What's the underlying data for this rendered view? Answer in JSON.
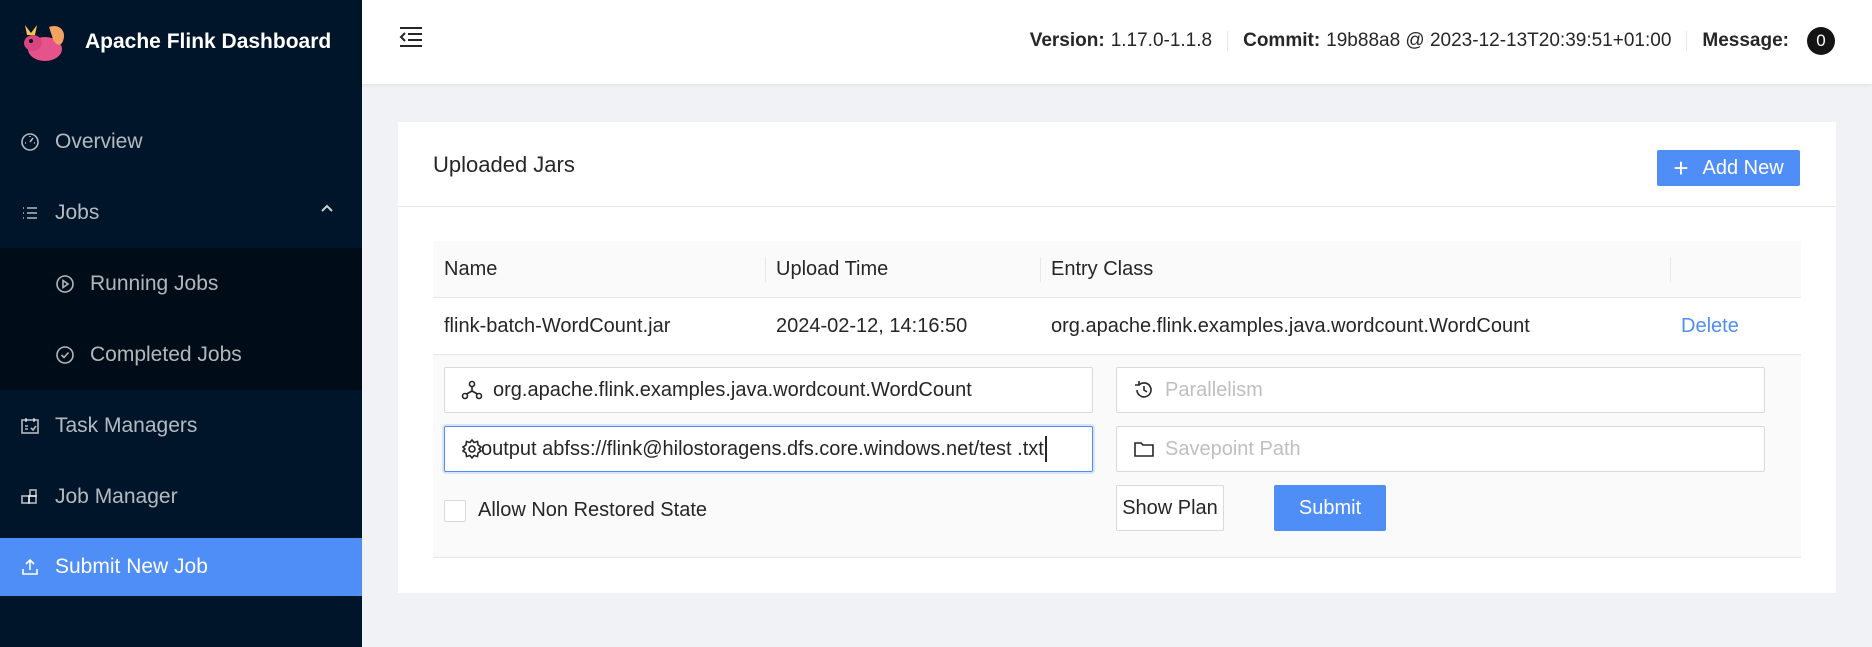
{
  "app": {
    "title": "Apache Flink Dashboard"
  },
  "sidebar": {
    "items": [
      {
        "label": "Overview",
        "icon": "dashboard-icon"
      },
      {
        "label": "Jobs",
        "icon": "list-icon",
        "expanded": true,
        "children": [
          {
            "label": "Running Jobs",
            "icon": "play-circle-icon"
          },
          {
            "label": "Completed Jobs",
            "icon": "check-circle-icon"
          }
        ]
      },
      {
        "label": "Task Managers",
        "icon": "schedule-icon"
      },
      {
        "label": "Job Manager",
        "icon": "build-icon"
      },
      {
        "label": "Submit New Job",
        "icon": "upload-icon",
        "active": true
      }
    ]
  },
  "header": {
    "version_label": "Version:",
    "version": "1.17.0-1.1.8",
    "commit_label": "Commit:",
    "commit": "19b88a8 @ 2023-12-13T20:39:51+01:00",
    "message_label": "Message:",
    "message_count": "0"
  },
  "card": {
    "title": "Uploaded Jars",
    "add_button": "Add New",
    "columns": [
      "Name",
      "Upload Time",
      "Entry Class"
    ],
    "rows": [
      {
        "name": "flink-batch-WordCount.jar",
        "upload_time": "2024-02-12, 14:16:50",
        "entry_class": "org.apache.flink.examples.java.wordcount.WordCount",
        "action": "Delete"
      }
    ],
    "form": {
      "entry_class_value": "org.apache.flink.examples.java.wordcount.WordCount",
      "parallelism_placeholder": "Parallelism",
      "program_args_value": "output abfss://flink@hilostoragens.dfs.core.windows.net/test .txt",
      "savepoint_placeholder": "Savepoint Path",
      "allow_non_restored_label": "Allow Non Restored State",
      "allow_non_restored_checked": false,
      "show_plan_button": "Show Plan",
      "submit_button": "Submit"
    }
  },
  "colors": {
    "sidebar_bg": "#001529",
    "submenu_bg": "#000c17",
    "accent": "#4f8ef7"
  }
}
